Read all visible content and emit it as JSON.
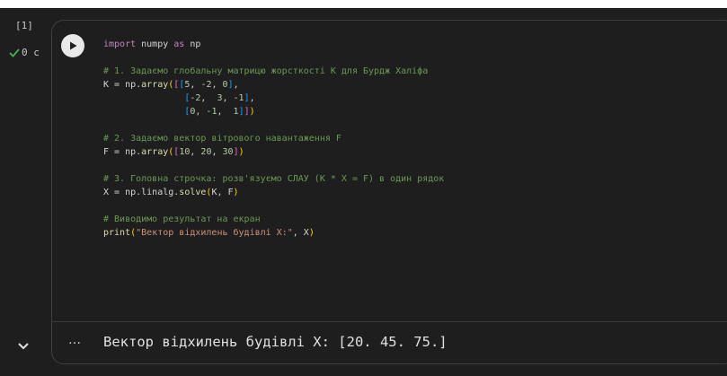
{
  "cell": {
    "execution_count": "[1]",
    "duration": "0 с",
    "output_text": "Вектор відхилень будівлі X: [20. 45. 75.]",
    "more_icon": "…"
  },
  "code": {
    "l1_kw": "import",
    "l1_rest": " numpy ",
    "l1_kw2": "as",
    "l1_end": " np",
    "c1": "# 1. Задаємо глобальну матрицю жорсткості K для Бурдж Халіфа",
    "l2_a": "K = np.",
    "l2_fn": "array",
    "l2_b1": "(",
    "l2_b2": "[",
    "l2_b3": "[",
    "l2_n1": "5",
    "l2_s1": ", ",
    "l2_n2": "-2",
    "l2_s2": ", ",
    "l2_n3": "0",
    "l2_c3": "]",
    "l2_end": ",",
    "l3_ind": "               ",
    "l3_o": "[",
    "l3_n1": "-2",
    "l3_s1": ",  ",
    "l3_n2": "3",
    "l3_s2": ", ",
    "l3_n3": "-1",
    "l3_c": "]",
    "l3_end": ",",
    "l4_ind": "               ",
    "l4_o": "[",
    "l4_n1": "0",
    "l4_s1": ", ",
    "l4_n2": "-1",
    "l4_s2": ",  ",
    "l4_n3": "1",
    "l4_c1": "]",
    "l4_c2": "]",
    "l4_c3": ")",
    "c2": "# 2. Задаємо вектор вітрового навантаження F",
    "l5_a": "F = np.",
    "l5_fn": "array",
    "l5_o1": "(",
    "l5_o2": "[",
    "l5_n1": "10",
    "l5_s1": ", ",
    "l5_n2": "20",
    "l5_s2": ", ",
    "l5_n3": "30",
    "l5_c2": "]",
    "l5_c1": ")",
    "c3": "# 3. Головна строчка: розв'язуємо СЛАУ (K * X = F) в один рядок",
    "l6_a": "X = np.linalg.",
    "l6_fn": "solve",
    "l6_o": "(",
    "l6_args": "K, F",
    "l6_c": ")",
    "c4": "# Виводимо результат на екран",
    "l7_fn": "print",
    "l7_o": "(",
    "l7_str": "\"Вектор відхилень будівлі X:\"",
    "l7_mid": ", X",
    "l7_c": ")"
  },
  "colors": {
    "background": "#1e1e1e",
    "comment": "#6a9955",
    "keyword": "#c586c0",
    "function": "#dcdcaa",
    "string": "#ce9178",
    "number": "#b5cea8",
    "status_check": "#4caf50"
  },
  "icons": {
    "run": "play-circle-icon",
    "status": "check-icon",
    "collapse": "chevron-down-icon",
    "more": "more-horizontal-icon"
  }
}
